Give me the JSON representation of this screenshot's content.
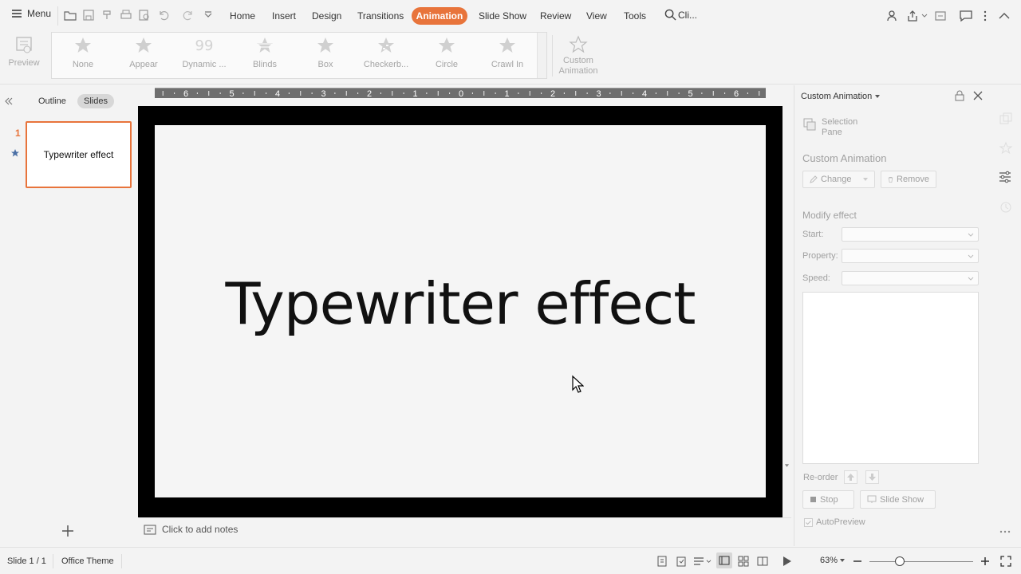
{
  "menu_label": "Menu",
  "tabs": [
    "Home",
    "Insert",
    "Design",
    "Transitions",
    "Animation",
    "Slide Show",
    "Review",
    "View",
    "Tools"
  ],
  "active_tab": "Animation",
  "search_label": "Cli...",
  "ribbon": {
    "preview_label": "Preview",
    "gallery": [
      "None",
      "Appear",
      "Dynamic ...",
      "Blinds",
      "Box",
      "Checkerb...",
      "Circle",
      "Crawl In"
    ],
    "custom_animation_label": "Custom Animation"
  },
  "left_pane": {
    "outline_tab": "Outline",
    "slides_tab": "Slides",
    "slide_number": "1",
    "thumbnail_text": "Typewriter effect"
  },
  "ruler_labels": [
    "6",
    "5",
    "4",
    "3",
    "2",
    "1",
    "0",
    "1",
    "2",
    "3",
    "4",
    "5",
    "6"
  ],
  "slide": {
    "title": "Typewriter effect"
  },
  "notes_placeholder": "Click to add notes",
  "right_panel": {
    "header": "Custom Animation",
    "selection_pane": "Selection Pane",
    "section_title": "Custom Animation",
    "change_button": "Change",
    "remove_button": "Remove",
    "modify_title": "Modify effect",
    "start_label": "Start:",
    "property_label": "Property:",
    "speed_label": "Speed:",
    "reorder_label": "Re-order",
    "stop_button": "Stop",
    "slideshow_button": "Slide Show",
    "autopreview_label": "AutoPreview"
  },
  "status": {
    "slide_info": "Slide 1 / 1",
    "theme": "Office Theme",
    "zoom": "63%"
  },
  "colors": {
    "accent": "#e8743b",
    "background": "#f3f3f3"
  }
}
